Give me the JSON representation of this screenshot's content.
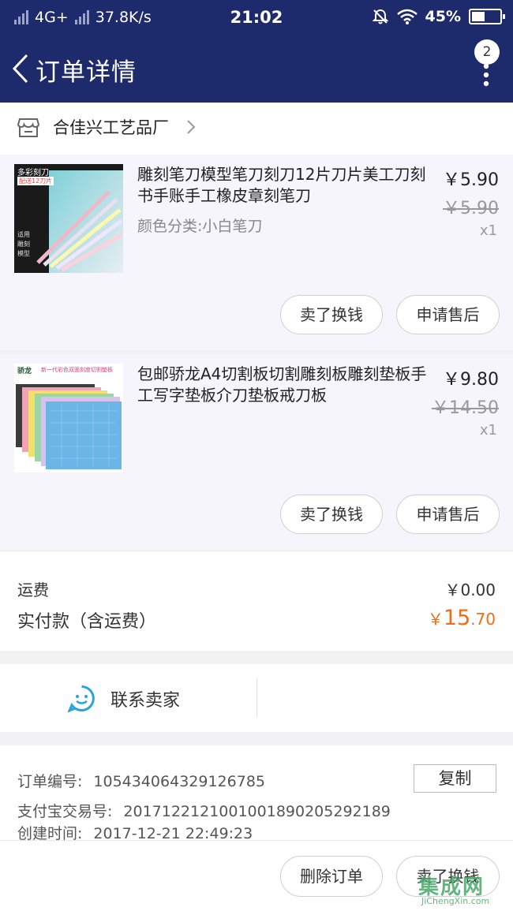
{
  "status_bar": {
    "network": "4G+",
    "speed": "37.8K/s",
    "time": "21:02",
    "battery": "45%"
  },
  "nav": {
    "title": "订单详情",
    "badge": "2"
  },
  "shop": {
    "name": "合佳兴工艺品厂"
  },
  "items": [
    {
      "title": "雕刻笔刀模型笔刀刻刀12片刀片美工刀刻书手账手工橡皮章刻笔刀",
      "spec": "颜色分类:小白笔刀",
      "price": "￥5.90",
      "original_price": "￥5.90",
      "qty": "x1",
      "thumb_text": "多彩刻刀",
      "thumb_sub": "配送12刀片",
      "sell_label": "卖了换钱",
      "aftersale_label": "申请售后"
    },
    {
      "title": "包邮骄龙A4切割板切割雕刻板雕刻垫板手工写字垫板介刀垫板戒刀板",
      "spec": "",
      "price": "￥9.80",
      "original_price": "￥14.50",
      "qty": "x1",
      "thumb_text": "骄龙",
      "thumb_sub": "新一代彩色双面刻度切割垫板",
      "sell_label": "卖了换钱",
      "aftersale_label": "申请售后"
    }
  ],
  "summary": {
    "shipping_label": "运费",
    "shipping_value": "￥0.00",
    "paid_label": "实付款（含运费）",
    "paid_currency": "￥",
    "paid_int": "15",
    "paid_dec": ".70"
  },
  "contact": {
    "label": "联系卖家"
  },
  "order_info": {
    "order_no_label": "订单编号:",
    "order_no": "105434064329126785",
    "copy_label": "复制",
    "alipay_label": "支付宝交易号:",
    "alipay_no": "2017122121001001890205292189",
    "created_label": "创建时间:",
    "created_time": "2017-12-21 22:49:23"
  },
  "bottom_bar": {
    "delete_label": "删除订单",
    "sell_label": "卖了换钱"
  },
  "watermark": {
    "text": "集成网",
    "url_text": "JiChengXin.com"
  },
  "colors": {
    "header": "#1d2a6b",
    "price_accent": "#f36c12",
    "contact_icon": "#29a3dc"
  }
}
